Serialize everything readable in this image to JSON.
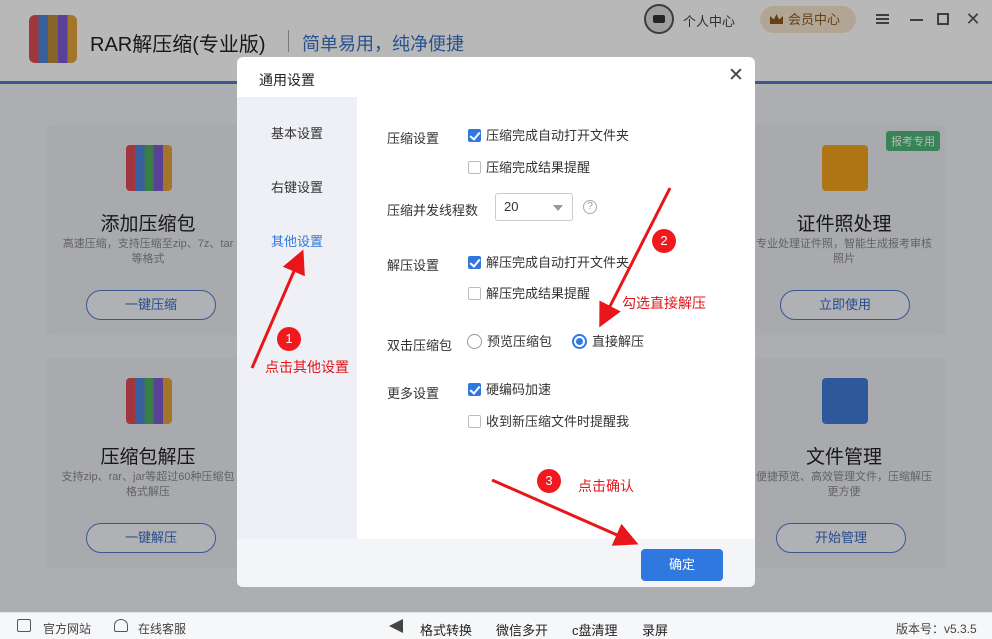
{
  "app": {
    "title": "RAR解压缩(专业版)",
    "slogan": "简单易用，纯净便捷",
    "user_center": "个人中心",
    "vip_label": "会员中心"
  },
  "cards": [
    {
      "title": "添加压缩包",
      "desc": "高速压缩，支持压缩至zip、7z、tar等格式",
      "button": "一键压缩"
    },
    {
      "title": "证件照处理",
      "desc": "专业处理证件照，智能生成报考审核照片",
      "button": "立即使用",
      "badge": "报考专用"
    },
    {
      "title": "压缩包解压",
      "desc": "支持zip、rar、jar等超过60种压缩包格式解压",
      "button": "一键解压"
    },
    {
      "title": "文件管理",
      "desc": "便捷预览、高效管理文件，压缩解压更方便",
      "button": "开始管理"
    }
  ],
  "dialog": {
    "title": "通用设置",
    "sidebar": [
      "基本设置",
      "右键设置",
      "其他设置"
    ],
    "active_tab": "其他设置",
    "compress_label": "压缩设置",
    "compress_open_folder": "压缩完成自动打开文件夹",
    "compress_open_folder_checked": true,
    "compress_result_remind": "压缩完成结果提醒",
    "compress_result_remind_checked": false,
    "threads_label": "压缩并发线程数",
    "threads_value": "20",
    "extract_label": "解压设置",
    "extract_open_folder": "解压完成自动打开文件夹",
    "extract_open_folder_checked": true,
    "extract_result_remind": "解压完成结果提醒",
    "extract_result_remind_checked": false,
    "double_click_label": "双击压缩包",
    "double_click_options": [
      "预览压缩包",
      "直接解压"
    ],
    "double_click_selected": "直接解压",
    "more_label": "更多设置",
    "hw_accel": "硬编码加速",
    "hw_accel_checked": true,
    "new_file_remind": "收到新压缩文件时提醒我",
    "new_file_remind_checked": false,
    "ok_button": "确定",
    "help_mark": "?"
  },
  "annotations": {
    "step1_num": "1",
    "step1_text": "点击其他设置",
    "step2_num": "2",
    "step2_text": "勾选直接解压",
    "step3_num": "3",
    "step3_text": "点击确认",
    "color": "#e0161b"
  },
  "statusbar": {
    "website": "官方网站",
    "support": "在线客服",
    "tools": [
      "格式转换",
      "微信多开",
      "c盘清理",
      "录屏"
    ],
    "version": "版本号：v5.3.5"
  },
  "colors": {
    "accent": "#2f78e0",
    "title_underline": "#4f79c9",
    "vip_bg": "#f5e6cf"
  }
}
